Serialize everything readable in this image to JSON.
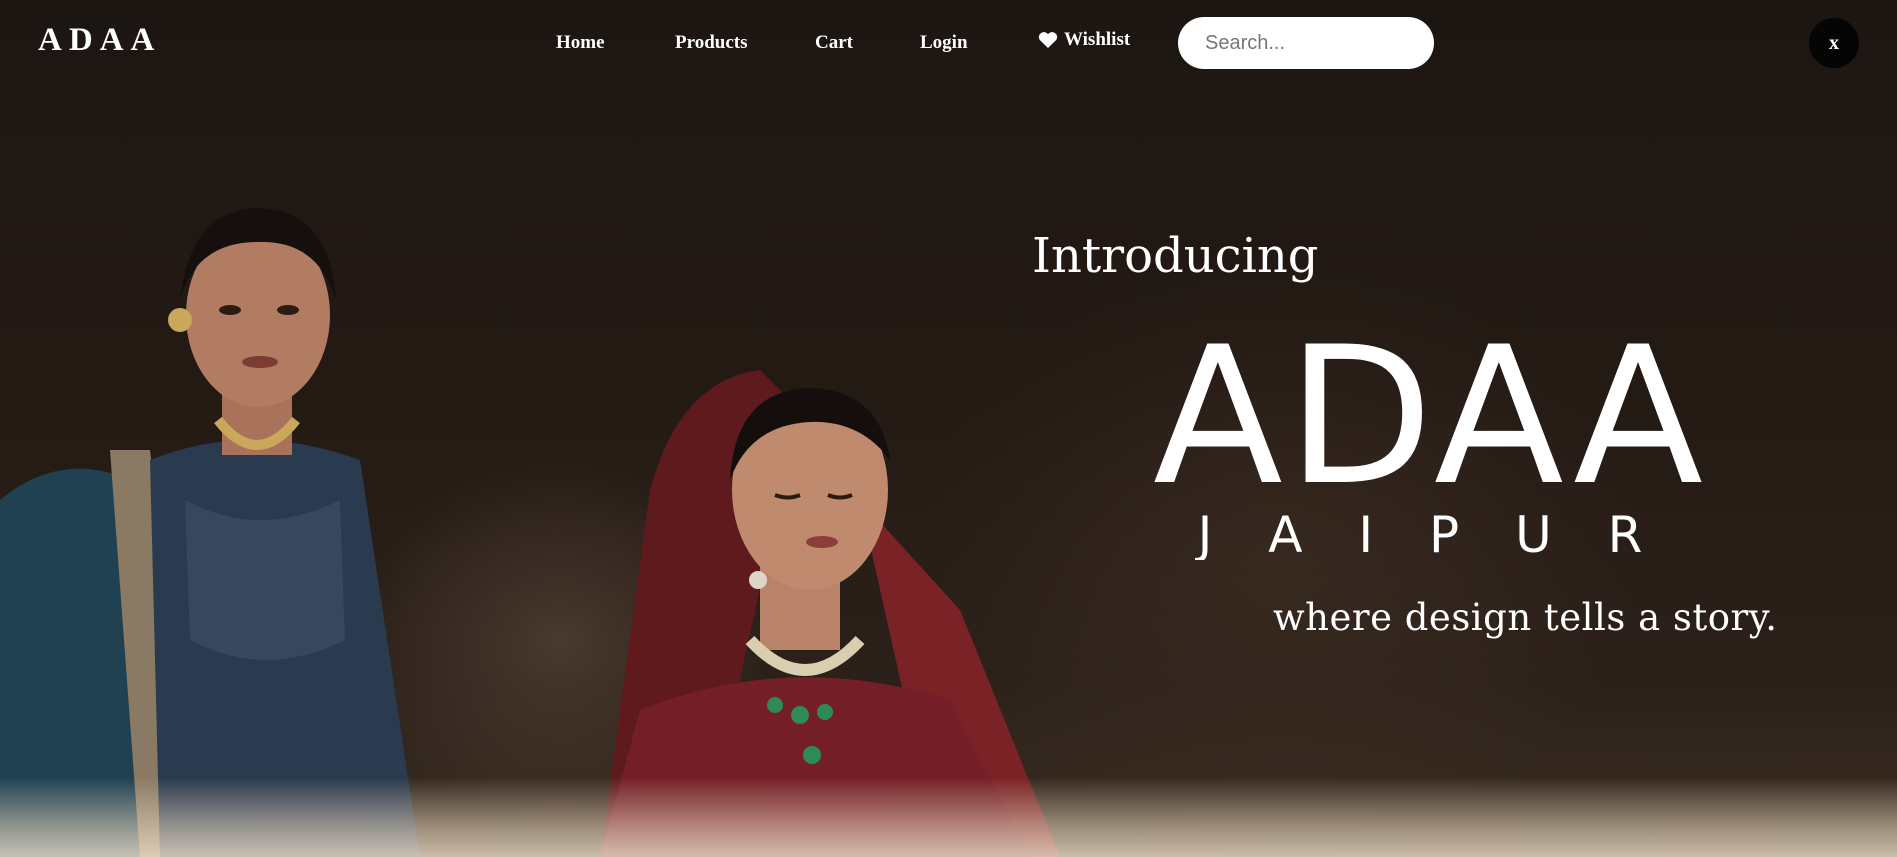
{
  "nav": {
    "logo": "ADAA",
    "links": [
      "Home",
      "Products",
      "Cart",
      "Login"
    ],
    "wishlist_label": "Wishlist",
    "search_placeholder": "Search...",
    "close_label": "x"
  },
  "hero": {
    "intro": "Introducing",
    "brand_name": "ADAA",
    "brand_city": "J A I P U R",
    "tagline": "where design tells a story."
  },
  "colors": {
    "background": "#1c1612",
    "text": "#ffffff",
    "search_bg": "#ffffff",
    "close_bg": "#050505"
  }
}
